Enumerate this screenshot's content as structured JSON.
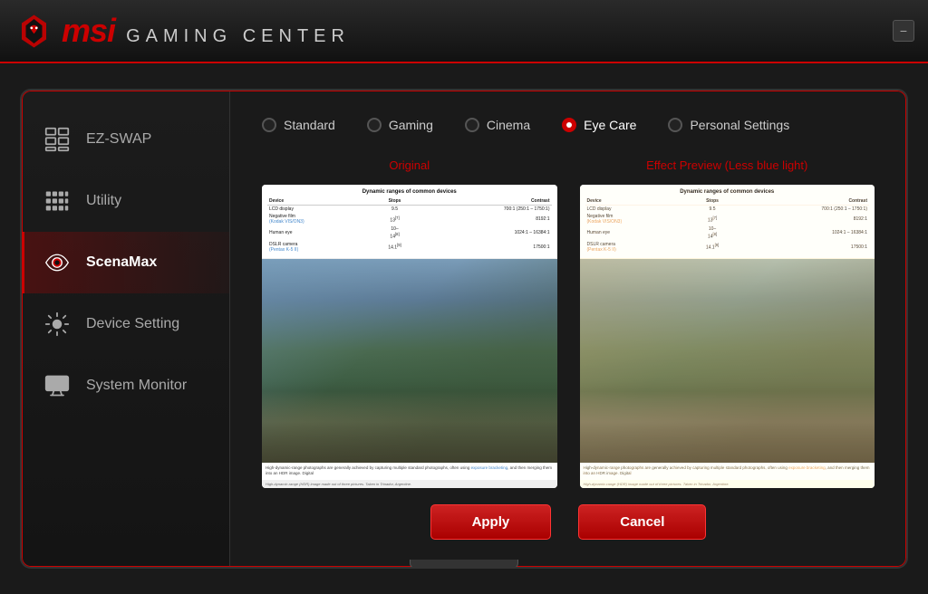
{
  "header": {
    "brand": "msi",
    "subtitle": "GAMING CENTER",
    "minimize_btn": "−"
  },
  "sidebar": {
    "items": [
      {
        "id": "ez-swap",
        "label": "EZ-SWAP",
        "icon": "grid-icon",
        "active": false
      },
      {
        "id": "utility",
        "label": "Utility",
        "icon": "utility-icon",
        "active": false
      },
      {
        "id": "scenamax",
        "label": "ScenaMax",
        "icon": "eye-icon",
        "active": true
      },
      {
        "id": "device-setting",
        "label": "Device Setting",
        "icon": "gear-icon",
        "active": false
      },
      {
        "id": "system-monitor",
        "label": "System Monitor",
        "icon": "monitor-icon",
        "active": false
      }
    ]
  },
  "content": {
    "modes": [
      {
        "id": "standard",
        "label": "Standard",
        "selected": false
      },
      {
        "id": "gaming",
        "label": "Gaming",
        "selected": false
      },
      {
        "id": "cinema",
        "label": "Cinema",
        "selected": false
      },
      {
        "id": "eye-care",
        "label": "Eye Care",
        "selected": true
      },
      {
        "id": "personal-settings",
        "label": "Personal Settings",
        "selected": false
      }
    ],
    "original_title": "Original",
    "effect_title": "Effect Preview (Less blue light)",
    "doc": {
      "table_title": "Dynamic ranges of common devices",
      "columns": [
        "Device",
        "Stops",
        "Contrast"
      ],
      "rows": [
        [
          "LCD display",
          "9.5",
          "700:1 (250:1 – 1750:1)"
        ],
        [
          "Negative film (Kodak VIS/ON3)",
          "13[7]",
          "8192:1"
        ],
        [
          "Human eye",
          "10–14[8]",
          "1024:1 – 16384:1"
        ],
        [
          "DSLR camera (Pentax K-5 II)",
          "14.1[9]",
          "17500:1"
        ]
      ],
      "caption_text": "High-dynamic-range photographs are generally achieved by capturing multiple standard photographs, often using exposure bracketing, and then merging them into an HDR image. Digital",
      "image_alt_caption": "High-dynamic-range (HDR) image made out of three pictures. Taken in Trinador, Argentine."
    },
    "buttons": {
      "apply": "Apply",
      "cancel": "Cancel"
    }
  }
}
